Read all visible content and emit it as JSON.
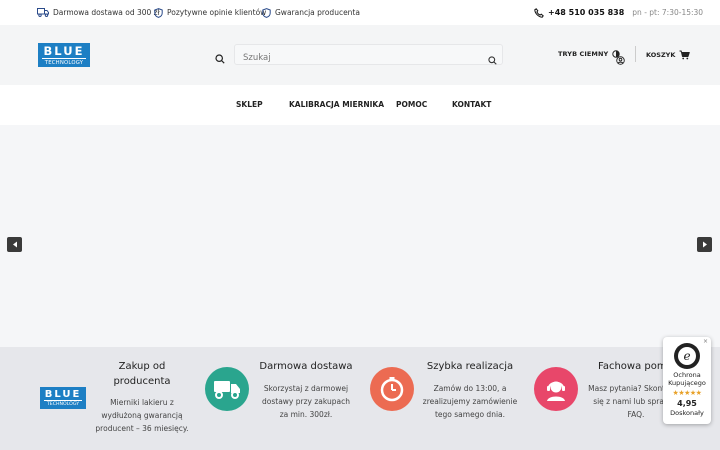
{
  "topbar": {
    "shipping": "Darmowa dostawa od 300 zł",
    "reviews": "Pozytywne opinie klientów",
    "warranty": "Gwarancja producenta",
    "phone": "+48 510 035 838",
    "hours": "pn - pt: 7:30-15:30"
  },
  "header": {
    "logo_big": "BLUE",
    "logo_small": "TECHNOLOGY",
    "search_placeholder": "Szukaj",
    "dark_mode_label": "TRYB CIEMNY",
    "cart_label": "KOSZYK"
  },
  "nav": {
    "items": [
      "SKLEP",
      "KALIBRACJA MIERNIKA",
      "POMOC",
      "KONTAKT"
    ]
  },
  "features": {
    "logo_big": "BLUE",
    "logo_small": "TECHNOLOGY",
    "items": [
      {
        "title": "Zakup od producenta",
        "text": "Mierniki lakieru z wydłużoną gwarancją producent – 36 miesięcy."
      },
      {
        "title": "Darmowa dostawa",
        "text": "Skorzystaj z darmowej dostawy przy zakupach za min. 300zł."
      },
      {
        "title": "Szybka realizacja",
        "text": "Zamów do 13:00, a zrealizujemy zamówienie tego samego dnia."
      },
      {
        "title": "Fachowa pomoc",
        "text": "Masz pytania? Skontaktuj się z nami lub sprawdź FAQ."
      }
    ],
    "colors": {
      "truck": "#2aa58e",
      "clock": "#ec6b52",
      "support": "#e8476a"
    }
  },
  "badge": {
    "close": "×",
    "seal_letter": "e",
    "label": "Ochrona Kupującego",
    "stars": "★★★★★",
    "score": "4,95",
    "verdict": "Doskonały"
  }
}
